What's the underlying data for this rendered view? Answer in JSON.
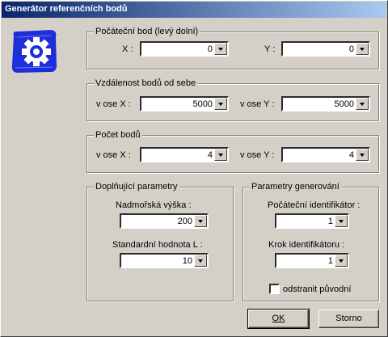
{
  "window": {
    "title": "Generátor referenčních bodů"
  },
  "groups": {
    "start": {
      "title": "Počáteční bod (levý dolní)",
      "x_label": "X :",
      "x_value": "0",
      "y_label": "Y :",
      "y_value": "0"
    },
    "distance": {
      "title": "Vzdálenost bodů od sebe",
      "x_label": "v ose X :",
      "x_value": "5000",
      "y_label": "v ose Y :",
      "y_value": "5000"
    },
    "count": {
      "title": "Počet bodů",
      "x_label": "v ose X :",
      "x_value": "4",
      "y_label": "v ose Y :",
      "y_value": "4"
    },
    "extra": {
      "title": "Doplňující parametry",
      "altitude_label": "Nadmořská výška :",
      "altitude_value": "200",
      "stddev_label": "Standardní hodnota L :",
      "stddev_value": "10"
    },
    "gen": {
      "title": "Parametry generování",
      "start_id_label": "Počáteční identifikátor :",
      "start_id_value": "1",
      "step_label": "Krok  identifikátoru :",
      "step_value": "1",
      "remove_label": "odstranit původní",
      "remove_checked": false
    }
  },
  "buttons": {
    "ok": "OK",
    "cancel": "Storno"
  },
  "colors": {
    "title_start": "#0a246a",
    "logo_blue": "#1c2fd8"
  },
  "icons": {
    "logo": "gear-icon"
  }
}
